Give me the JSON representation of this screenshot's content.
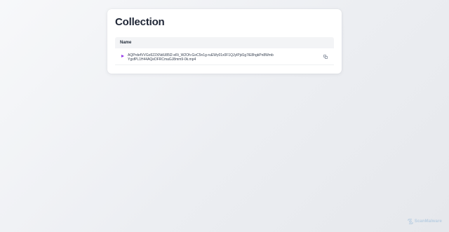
{
  "page": {
    "title": "Collection"
  },
  "table": {
    "columns": [
      "Name"
    ],
    "rows": [
      {
        "type": "video",
        "name": "AQPrdefVVGo522XNdU85l2-eRi_W2Oh-GoC5n1g-ruEWy01x0F1QJyIPjd1g7iE8hgkPn8WmbYgsfPL1H44AQeDFRCmaGJ8mm9-0k.mp4"
      }
    ]
  },
  "icons": {
    "play": "play-icon",
    "copy": "copy-icon",
    "brand_logo": "scanmalware-logo-icon"
  },
  "branding": {
    "name": "ScanMalware"
  },
  "colors": {
    "accent_play": "#9333ea",
    "brand": "#93b8d8"
  }
}
